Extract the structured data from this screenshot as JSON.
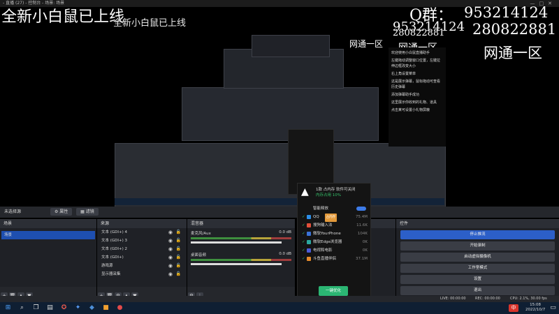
{
  "window": {
    "title": "- 直播 (27) - 控制台 - 场景: 场景"
  },
  "overlay": {
    "main_slogan": "全新小白鼠已上线",
    "qq_label": "Q群：",
    "qq_number_1": "953214124",
    "qq_number_2": "280822881",
    "qq_number_3": "280822881",
    "region": "网通一区"
  },
  "notes": {
    "lines": [
      "欢迎使用小白鼠直播助手",
      "左键拖动调整窗口位置，左键拉伸边框改变大小",
      "右上角设置菜单",
      "这是展示弹幕，鼠标拖动可查看历史弹幕",
      "添加弹幕助手成功",
      "这里展示你收到的礼物、道具",
      "点击某可设置小礼物屏蔽"
    ]
  },
  "mode_bar": {
    "label": "未选择源",
    "props": "属性",
    "filters": "滤镜"
  },
  "scenes": {
    "title": "场景",
    "items": [
      "场景"
    ]
  },
  "sources": {
    "title": "来源",
    "items": [
      "文本 (GDI+) 4",
      "文本 (GDI+) 3",
      "文本 (GDI+) 2",
      "文本 (GDI+)",
      "游戏源",
      "显示器采集"
    ]
  },
  "mixer": {
    "title": "混音器",
    "channels": [
      {
        "name": "麦克风/Aux",
        "level": "0.0 dB"
      },
      {
        "name": "桌面音频",
        "level": "0.0 dB"
      }
    ]
  },
  "controls": {
    "title": "控件",
    "buttons": [
      "停止推流",
      "开始录制",
      "启动虚拟摄像机",
      "工作室模式",
      "设置",
      "退出"
    ]
  },
  "popup": {
    "app": "1款 占内存 软件可关闭",
    "sub": "内存占用 10%",
    "toggle_label": "智能释放",
    "rows": [
      {
        "name": "QQ",
        "tag": "占内存",
        "size": "75.4M",
        "color": "#2c8fe8"
      },
      {
        "name": "搜狗输入法",
        "tag": "",
        "size": "11.6K",
        "color": "#e2503a"
      },
      {
        "name": "微软YourPhone",
        "tag": "",
        "size": "104K",
        "color": "#3a73d8"
      },
      {
        "name": "微软Edge浏览器",
        "tag": "",
        "size": "0K",
        "color": "#2ba8a0"
      },
      {
        "name": "电视和电影",
        "tag": "",
        "size": "0K",
        "color": "#4a5bd8"
      },
      {
        "name": "斗鱼直播伴侣",
        "tag": "",
        "size": "37.1M",
        "color": "#e48a2a"
      }
    ],
    "accel_button": "一键优化"
  },
  "status": {
    "live": "LIVE: 00:00:00",
    "rec": "REC: 00:00:00",
    "cpu": "CPU: 2.1%, 30.00 fps"
  },
  "taskbar": {
    "time": "15:08",
    "date": "2022/10/7",
    "ime": "中"
  }
}
